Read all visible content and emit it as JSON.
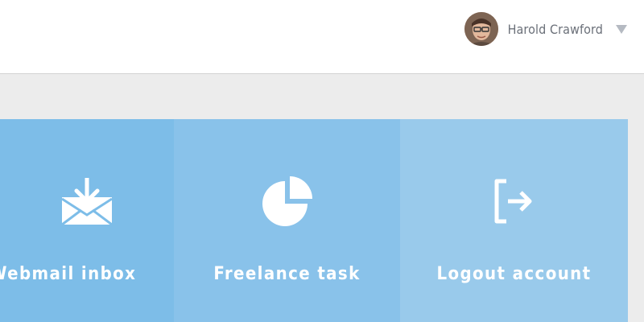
{
  "header": {
    "user": {
      "name": "Harold Crawford",
      "avatar_icon": "user-avatar"
    }
  },
  "tiles": [
    {
      "label": "Webmail inbox",
      "icon": "mail-download-icon"
    },
    {
      "label": "Freelance task",
      "icon": "pie-chart-icon"
    },
    {
      "label": "Logout account",
      "icon": "logout-icon"
    }
  ],
  "colors": {
    "topbar_bg": "#ffffff",
    "page_bg": "#ececec",
    "tile_1": "#7dbde8",
    "tile_2": "#89c2ea",
    "tile_3": "#99caeb",
    "username_text": "#6b7079"
  }
}
